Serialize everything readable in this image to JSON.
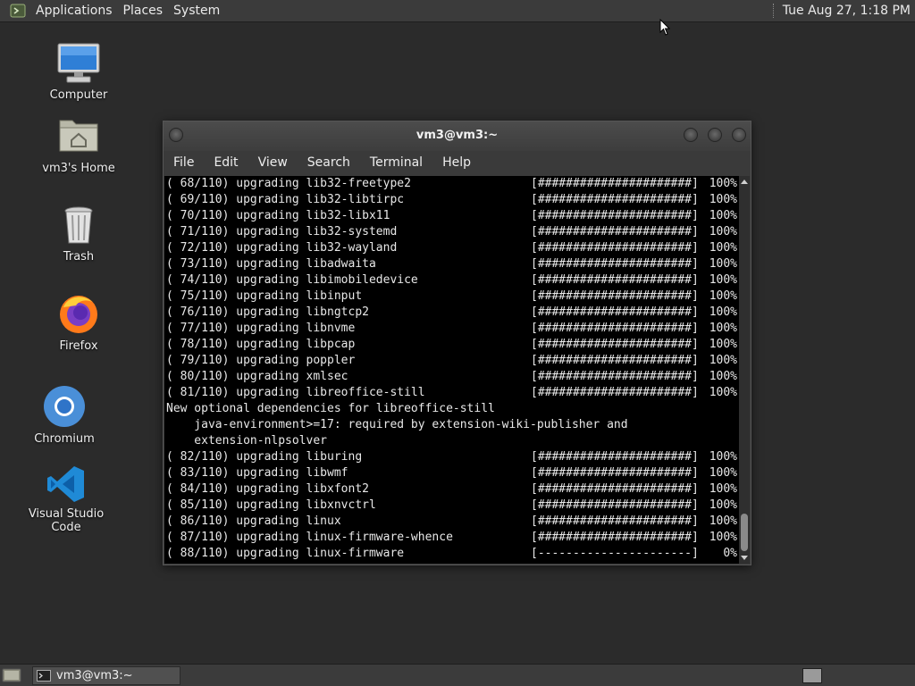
{
  "top_panel": {
    "menus": [
      "Applications",
      "Places",
      "System"
    ],
    "clock": "Tue Aug 27,  1:18 PM",
    "logo_icon": "terminal-logo-icon"
  },
  "desktop": {
    "icons": [
      {
        "label": "Computer",
        "icon": "computer-icon"
      },
      {
        "label": "vm3's Home",
        "icon": "home-folder-icon"
      },
      {
        "label": "Trash",
        "icon": "trash-icon"
      },
      {
        "label": "Firefox",
        "icon": "firefox-icon"
      },
      {
        "label": "Chromium",
        "icon": "chromium-icon"
      },
      {
        "label": "Visual Studio Code",
        "icon": "vscode-icon"
      }
    ]
  },
  "terminal": {
    "title": "vm3@vm3:~",
    "menu": [
      "File",
      "Edit",
      "View",
      "Search",
      "Terminal",
      "Help"
    ],
    "lines": [
      {
        "text": "( 68/110) upgrading lib32-freetype2",
        "bar": "[######################]",
        "pct": "100%"
      },
      {
        "text": "( 69/110) upgrading lib32-libtirpc",
        "bar": "[######################]",
        "pct": "100%"
      },
      {
        "text": "( 70/110) upgrading lib32-libx11",
        "bar": "[######################]",
        "pct": "100%"
      },
      {
        "text": "( 71/110) upgrading lib32-systemd",
        "bar": "[######################]",
        "pct": "100%"
      },
      {
        "text": "( 72/110) upgrading lib32-wayland",
        "bar": "[######################]",
        "pct": "100%"
      },
      {
        "text": "( 73/110) upgrading libadwaita",
        "bar": "[######################]",
        "pct": "100%"
      },
      {
        "text": "( 74/110) upgrading libimobiledevice",
        "bar": "[######################]",
        "pct": "100%"
      },
      {
        "text": "( 75/110) upgrading libinput",
        "bar": "[######################]",
        "pct": "100%"
      },
      {
        "text": "( 76/110) upgrading libngtcp2",
        "bar": "[######################]",
        "pct": "100%"
      },
      {
        "text": "( 77/110) upgrading libnvme",
        "bar": "[######################]",
        "pct": "100%"
      },
      {
        "text": "( 78/110) upgrading libpcap",
        "bar": "[######################]",
        "pct": "100%"
      },
      {
        "text": "( 79/110) upgrading poppler",
        "bar": "[######################]",
        "pct": "100%"
      },
      {
        "text": "( 80/110) upgrading xmlsec",
        "bar": "[######################]",
        "pct": "100%"
      },
      {
        "text": "( 81/110) upgrading libreoffice-still",
        "bar": "[######################]",
        "pct": "100%"
      },
      {
        "text": "New optional dependencies for libreoffice-still",
        "bar": "",
        "pct": ""
      },
      {
        "text": "    java-environment>=17: required by extension-wiki-publisher and",
        "bar": "",
        "pct": ""
      },
      {
        "text": "    extension-nlpsolver",
        "bar": "",
        "pct": ""
      },
      {
        "text": "( 82/110) upgrading liburing",
        "bar": "[######################]",
        "pct": "100%"
      },
      {
        "text": "( 83/110) upgrading libwmf",
        "bar": "[######################]",
        "pct": "100%"
      },
      {
        "text": "( 84/110) upgrading libxfont2",
        "bar": "[######################]",
        "pct": "100%"
      },
      {
        "text": "( 85/110) upgrading libxnvctrl",
        "bar": "[######################]",
        "pct": "100%"
      },
      {
        "text": "( 86/110) upgrading linux",
        "bar": "[######################]",
        "pct": "100%"
      },
      {
        "text": "( 87/110) upgrading linux-firmware-whence",
        "bar": "[######################]",
        "pct": "100%"
      },
      {
        "text": "( 88/110) upgrading linux-firmware",
        "bar": "[----------------------]",
        "pct": "0%"
      }
    ]
  },
  "bottom_panel": {
    "task": "vm3@vm3:~",
    "show_desktop_icon": "show-desktop-icon",
    "workspace_icon": "workspace-switcher-icon"
  },
  "colors": {
    "desktop_bg": "#2b2b2b",
    "panel_bg": "#3b3b3b",
    "terminal_bg": "#000000",
    "terminal_fg": "#e8e8e8"
  }
}
